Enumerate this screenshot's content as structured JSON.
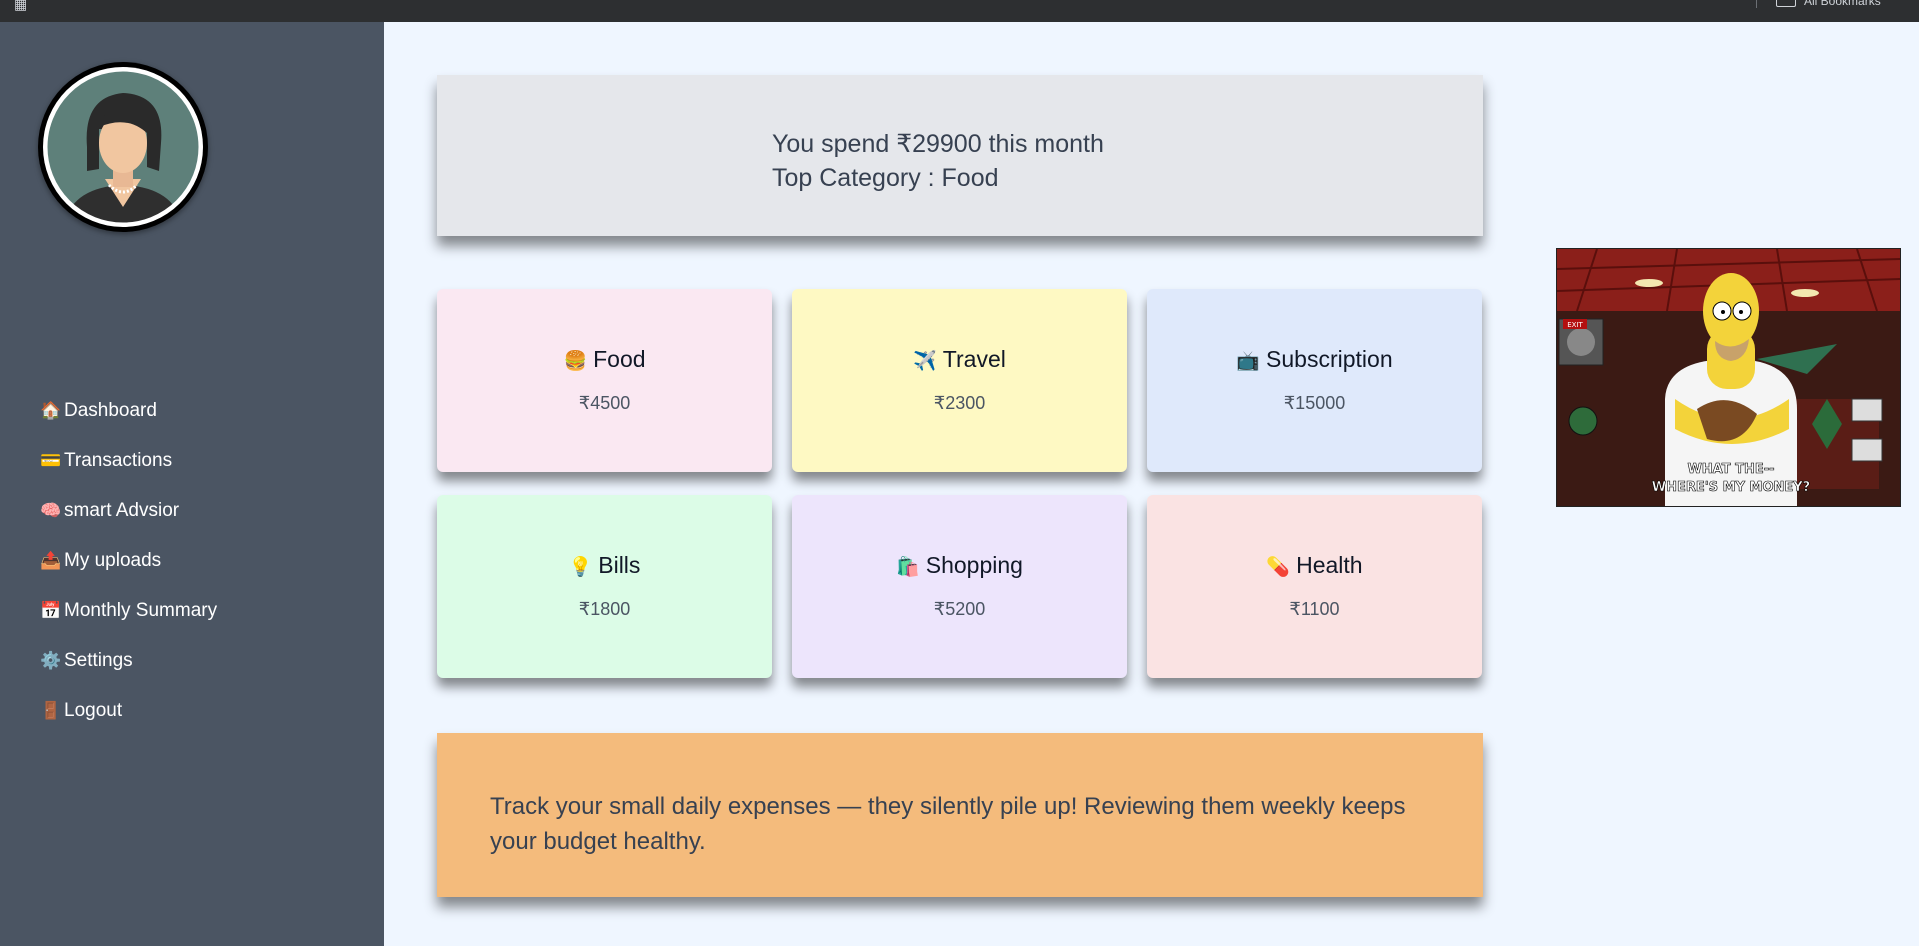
{
  "topbar": {
    "apps_icon": "apps-grid-icon",
    "bookmarks_label": "All Bookmarks"
  },
  "sidebar": {
    "avatar_icon": "user-avatar-icon",
    "items": [
      {
        "icon": "🏠",
        "label": "Dashboard"
      },
      {
        "icon": "💳",
        "label": "Transactions"
      },
      {
        "icon": "🧠",
        "label": "smart Advsior"
      },
      {
        "icon": "📤",
        "label": "My uploads"
      },
      {
        "icon": "📅",
        "label": "Monthly Summary"
      },
      {
        "icon": "⚙️",
        "label": "Settings"
      },
      {
        "icon": "🚪",
        "label": "Logout"
      }
    ]
  },
  "summary": {
    "spend_text": "You spend ₹29900 this month",
    "top_category_text": "Top Category : Food"
  },
  "categories": [
    {
      "icon": "🍔",
      "name": "Food",
      "amount": "₹4500",
      "color": "#fae8f2"
    },
    {
      "icon": "✈️",
      "name": "Travel",
      "amount": "₹2300",
      "color": "#fef9c3"
    },
    {
      "icon": "📺",
      "name": "Subscription",
      "amount": "₹15000",
      "color": "#dfe9fb"
    },
    {
      "icon": "💡",
      "name": "Bills",
      "amount": "₹1800",
      "color": "#dcfce7"
    },
    {
      "icon": "🛍️",
      "name": "Shopping",
      "amount": "₹5200",
      "color": "#ede5fc"
    },
    {
      "icon": "💊",
      "name": "Health",
      "amount": "₹1100",
      "color": "#fae3e3"
    }
  ],
  "tip": {
    "text": "Track your small daily expenses — they silently pile up! Reviewing them weekly keeps your budget healthy."
  },
  "meme": {
    "caption_line1": "WHAT THE--",
    "caption_line2": "WHERE'S MY MONEY?",
    "exit_sign": "EXIT"
  }
}
